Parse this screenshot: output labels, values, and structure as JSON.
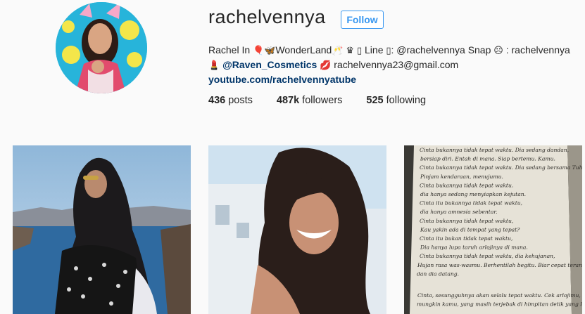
{
  "profile": {
    "username": "rachelvennya",
    "follow_label": "Follow",
    "bio_line1_a": "Rachel In ",
    "bio_line1_b": "WonderLand",
    "bio_line1_c": " Line ",
    "bio_line1_d": ": @rachelvennya Snap ",
    "bio_line1_e": " : rachelvennya",
    "bio_line2_handle": "@Raven_Cosmetics",
    "bio_line2_email": " rachelvennya23@gmail.com",
    "website": "youtube.com/rachelvennyatube"
  },
  "stats": {
    "posts_count": "436",
    "posts_label": " posts",
    "followers_count": "487k",
    "followers_label": " followers",
    "following_count": "525",
    "following_label": " following"
  },
  "book_page": {
    "lines": [
      "Cinta bukannya tidak tepat waktu. Dia sedang dandan,",
      "bersiap diri. Entah di mana. Siap bertemu. Kamu.",
      "Cinta bukannya tidak tepat waktu. Dia sedang bersama Tuhan,",
      "Pinjam kendaraan, menujumu.",
      "Cinta bukannya tidak tepat waktu.",
      "dia hanya sedang menyiapkan kejutan.",
      "Cinta itu bukannya tidak tepat waktu,",
      "dia hanya amnesia sebentar.",
      "Cinta bukannya tidak tepat waktu,",
      "Kau yakin ada di tempat yang tepat?",
      "Cinta itu bukan tidak tepat waktu,",
      "Dia hanya lupa taruh arlojinya di mana.",
      "Cinta bukannya tidak tepat waktu, dia kehujanan,",
      "Hujan rasa was-wasmu. Berhentilah begitu. Biar cepat terang,",
      "dan dia datang.",
      "Cinta, sesungguhnya akan selalu tepat waktu. Cek arlojimu,",
      "mungkin kamu, yang masih terjebak di himpitan detik yang lalu."
    ]
  }
}
